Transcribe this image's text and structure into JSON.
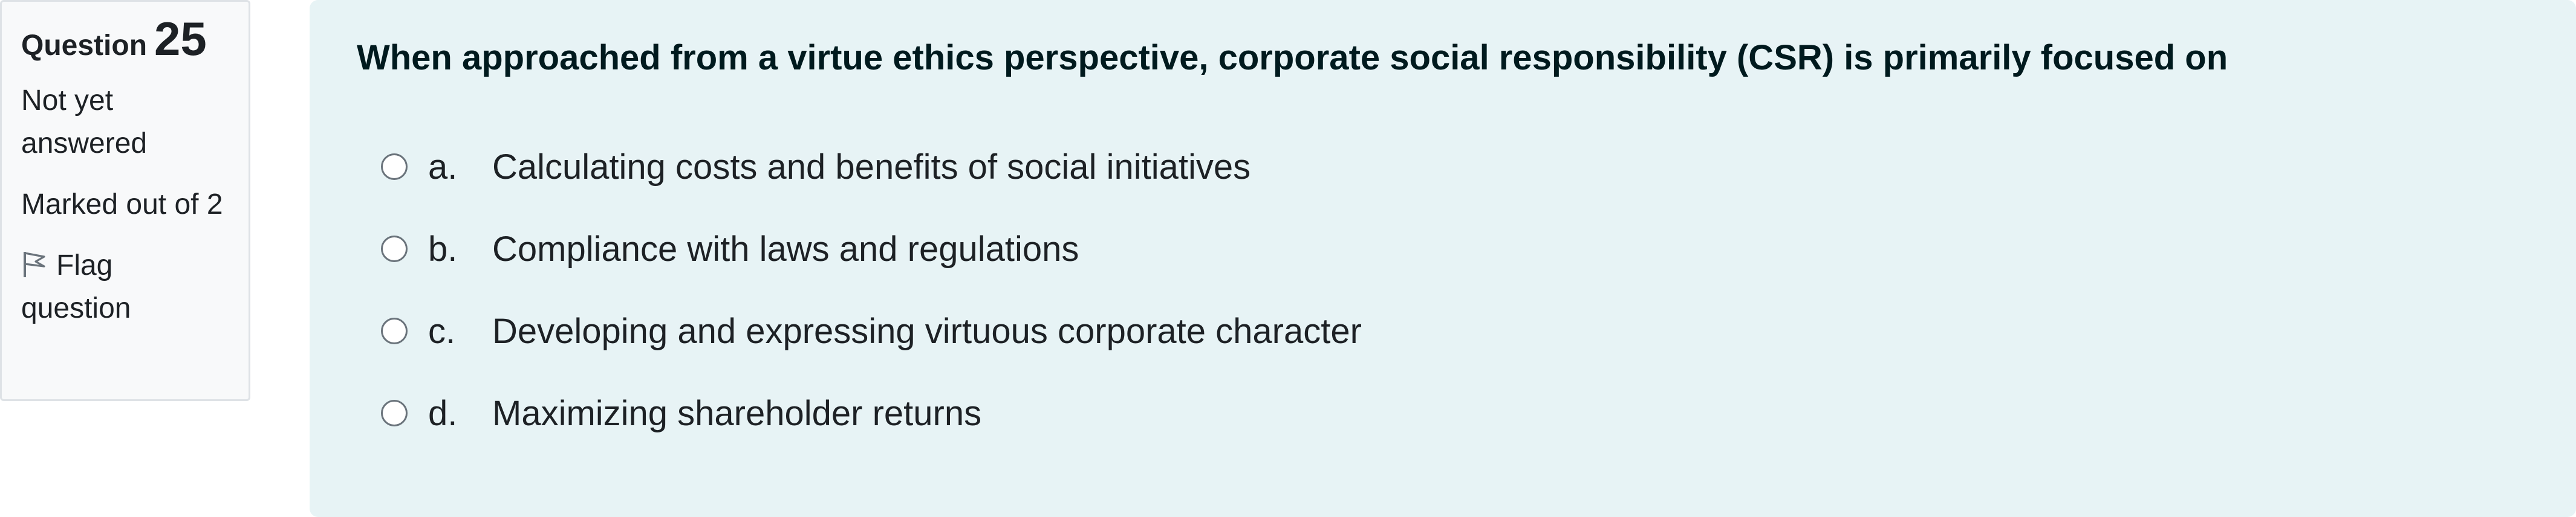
{
  "info": {
    "question_label": "Question",
    "question_number": "25",
    "state": "Not yet answered",
    "grade": "Marked out of 2",
    "flag_label": "Flag question",
    "flag_icon": "flag-icon"
  },
  "question": {
    "text": "When approached from a virtue ethics perspective, corporate social responsibility (CSR) is primarily focused on",
    "answers": [
      {
        "letter": "a.",
        "text": "Calculating costs and benefits of social initiatives"
      },
      {
        "letter": "b.",
        "text": "Compliance with laws and regulations"
      },
      {
        "letter": "c.",
        "text": "Developing and expressing virtuous corporate character"
      },
      {
        "letter": "d.",
        "text": "Maximizing shareholder returns"
      }
    ]
  },
  "colors": {
    "info_background": "#f8f9fa",
    "content_background": "#e7f3f5",
    "text": "#1d2125"
  }
}
